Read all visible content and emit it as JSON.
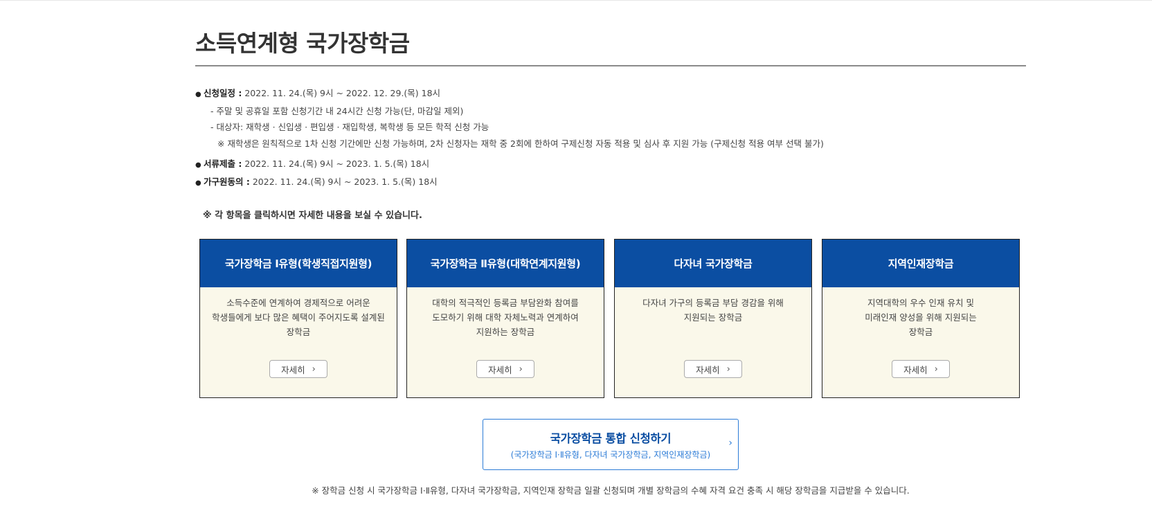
{
  "title": "소득연계형 국가장학금",
  "schedule": {
    "apply_label": "신청일정 :",
    "apply_value": "2022. 11. 24.(목) 9시 ~ 2022. 12. 29.(목) 18시",
    "sub1": "- 주말 및 공휴일 포함 신청기간 내 24시간 신청 가능(단, 마감일 제외)",
    "sub2": "- 대상자: 재학생 · 신입생 · 편입생 · 재입학생, 복학생 등 모든 학적 신청 가능",
    "note": "※ 재학생은 원칙적으로 1차 신청 기간에만 신청 가능하며, 2차 신청자는 재학 중 2회에 한하여 구제신청 자동 적용 및 심사 후 지원 가능 (구제신청 적용 여부 선택 불가)",
    "docs_label": "서류제출 :",
    "docs_value": "2022. 11. 24.(목) 9시 ~ 2023. 1. 5.(목) 18시",
    "consent_label": "가구원동의 :",
    "consent_value": "2022. 11. 24.(목) 9시 ~ 2023. 1. 5.(목) 18시"
  },
  "click_note": "※ 각 항목을 클릭하시면 자세한 내용을 보실 수 있습니다.",
  "cards": [
    {
      "title": "국가장학금 Ⅰ유형(학생직접지원형)",
      "desc": "소득수준에 연계하여 경제적으로 어려운\n학생들에게 보다 많은 혜택이 주어지도록 설계된\n장학금",
      "button": "자세히"
    },
    {
      "title": "국가장학금 Ⅱ유형(대학연계지원형)",
      "desc": "대학의 적극적인 등록금 부담완화 참여를\n도모하기 위해 대학 자체노력과 연계하여\n지원하는 장학금",
      "button": "자세히"
    },
    {
      "title": "다자녀 국가장학금",
      "desc": "다자녀 가구의 등록금 부담 경감을 위해\n지원되는 장학금",
      "button": "자세히"
    },
    {
      "title": "지역인재장학금",
      "desc": "지역대학의 우수 인재 유치 및\n미래인재 양성을 위해 지원되는\n장학금",
      "button": "자세히"
    }
  ],
  "apply": {
    "title": "국가장학금 통합 신청하기",
    "subtitle": "(국가장학금 Ⅰ·Ⅱ유형, 다자녀 국가장학금, 지역인재장학금)"
  },
  "bottom_note": "※ 장학금 신청 시 국가장학금 Ⅰ·Ⅱ유형, 다자녀 국가장학금, 지역인재 장학금 일괄 신청되며 개별 장학금의 수혜 자격 요건 충족 시 해당 장학금을 지급받을 수 있습니다.",
  "colors": {
    "card_header": "#0b4ea2",
    "card_body": "#faf8ea",
    "apply_border": "#2b7bd6"
  }
}
